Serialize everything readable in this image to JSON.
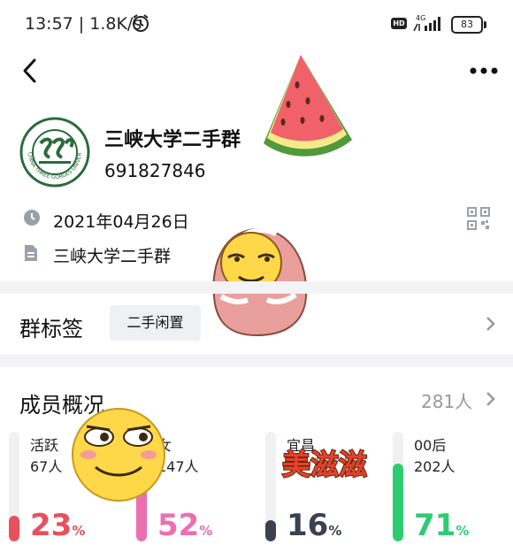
{
  "status_bar": {
    "time": "13:57 | 1.8K/s",
    "network": "4G",
    "battery": "83"
  },
  "group": {
    "name": "三峡大学二手群",
    "id": "691827846",
    "date": "2021年04月26日",
    "description": "三峡大学二手群"
  },
  "tags": {
    "title": "群标签",
    "chip": "二手闲置"
  },
  "members": {
    "title": "成员概况",
    "count": "281人",
    "stats": [
      {
        "label": "活跃",
        "value": "67人",
        "percent": 23,
        "color": "#e8505b"
      },
      {
        "label": "女",
        "value": "147人",
        "percent": 52,
        "color": "#ec6fb0"
      },
      {
        "label": "宜昌",
        "value": "",
        "percent": 16,
        "color": "#3a4150"
      },
      {
        "label": "00后",
        "value": "202人",
        "percent": 71,
        "color": "#2ecc71"
      }
    ]
  },
  "stickers": {
    "logo_text": "CHINA THREE GORGES UNIVERSITY",
    "meizizi": "美滋滋"
  },
  "icons": [
    "back-arrow-icon",
    "more-dots-icon",
    "clock-icon",
    "qr-code-icon",
    "document-icon",
    "chevron-right-icon",
    "alarm-icon",
    "signal-icon",
    "battery-icon"
  ]
}
